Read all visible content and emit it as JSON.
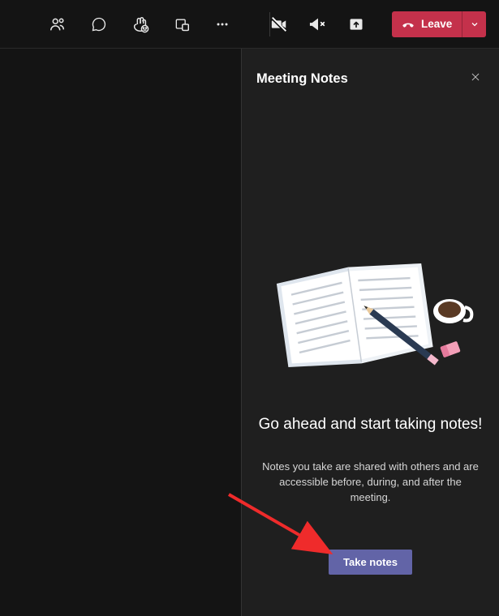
{
  "toolbar": {
    "leave_label": "Leave"
  },
  "panel": {
    "title": "Meeting Notes",
    "heading": "Go ahead and start taking notes!",
    "description": "Notes you take are shared with others and are accessible before, during, and after the meeting.",
    "button_label": "Take notes"
  },
  "colors": {
    "leave_bg": "#c4314b",
    "accent": "#6264a7",
    "panel_bg": "#1f1f1f",
    "app_bg": "#141414"
  }
}
